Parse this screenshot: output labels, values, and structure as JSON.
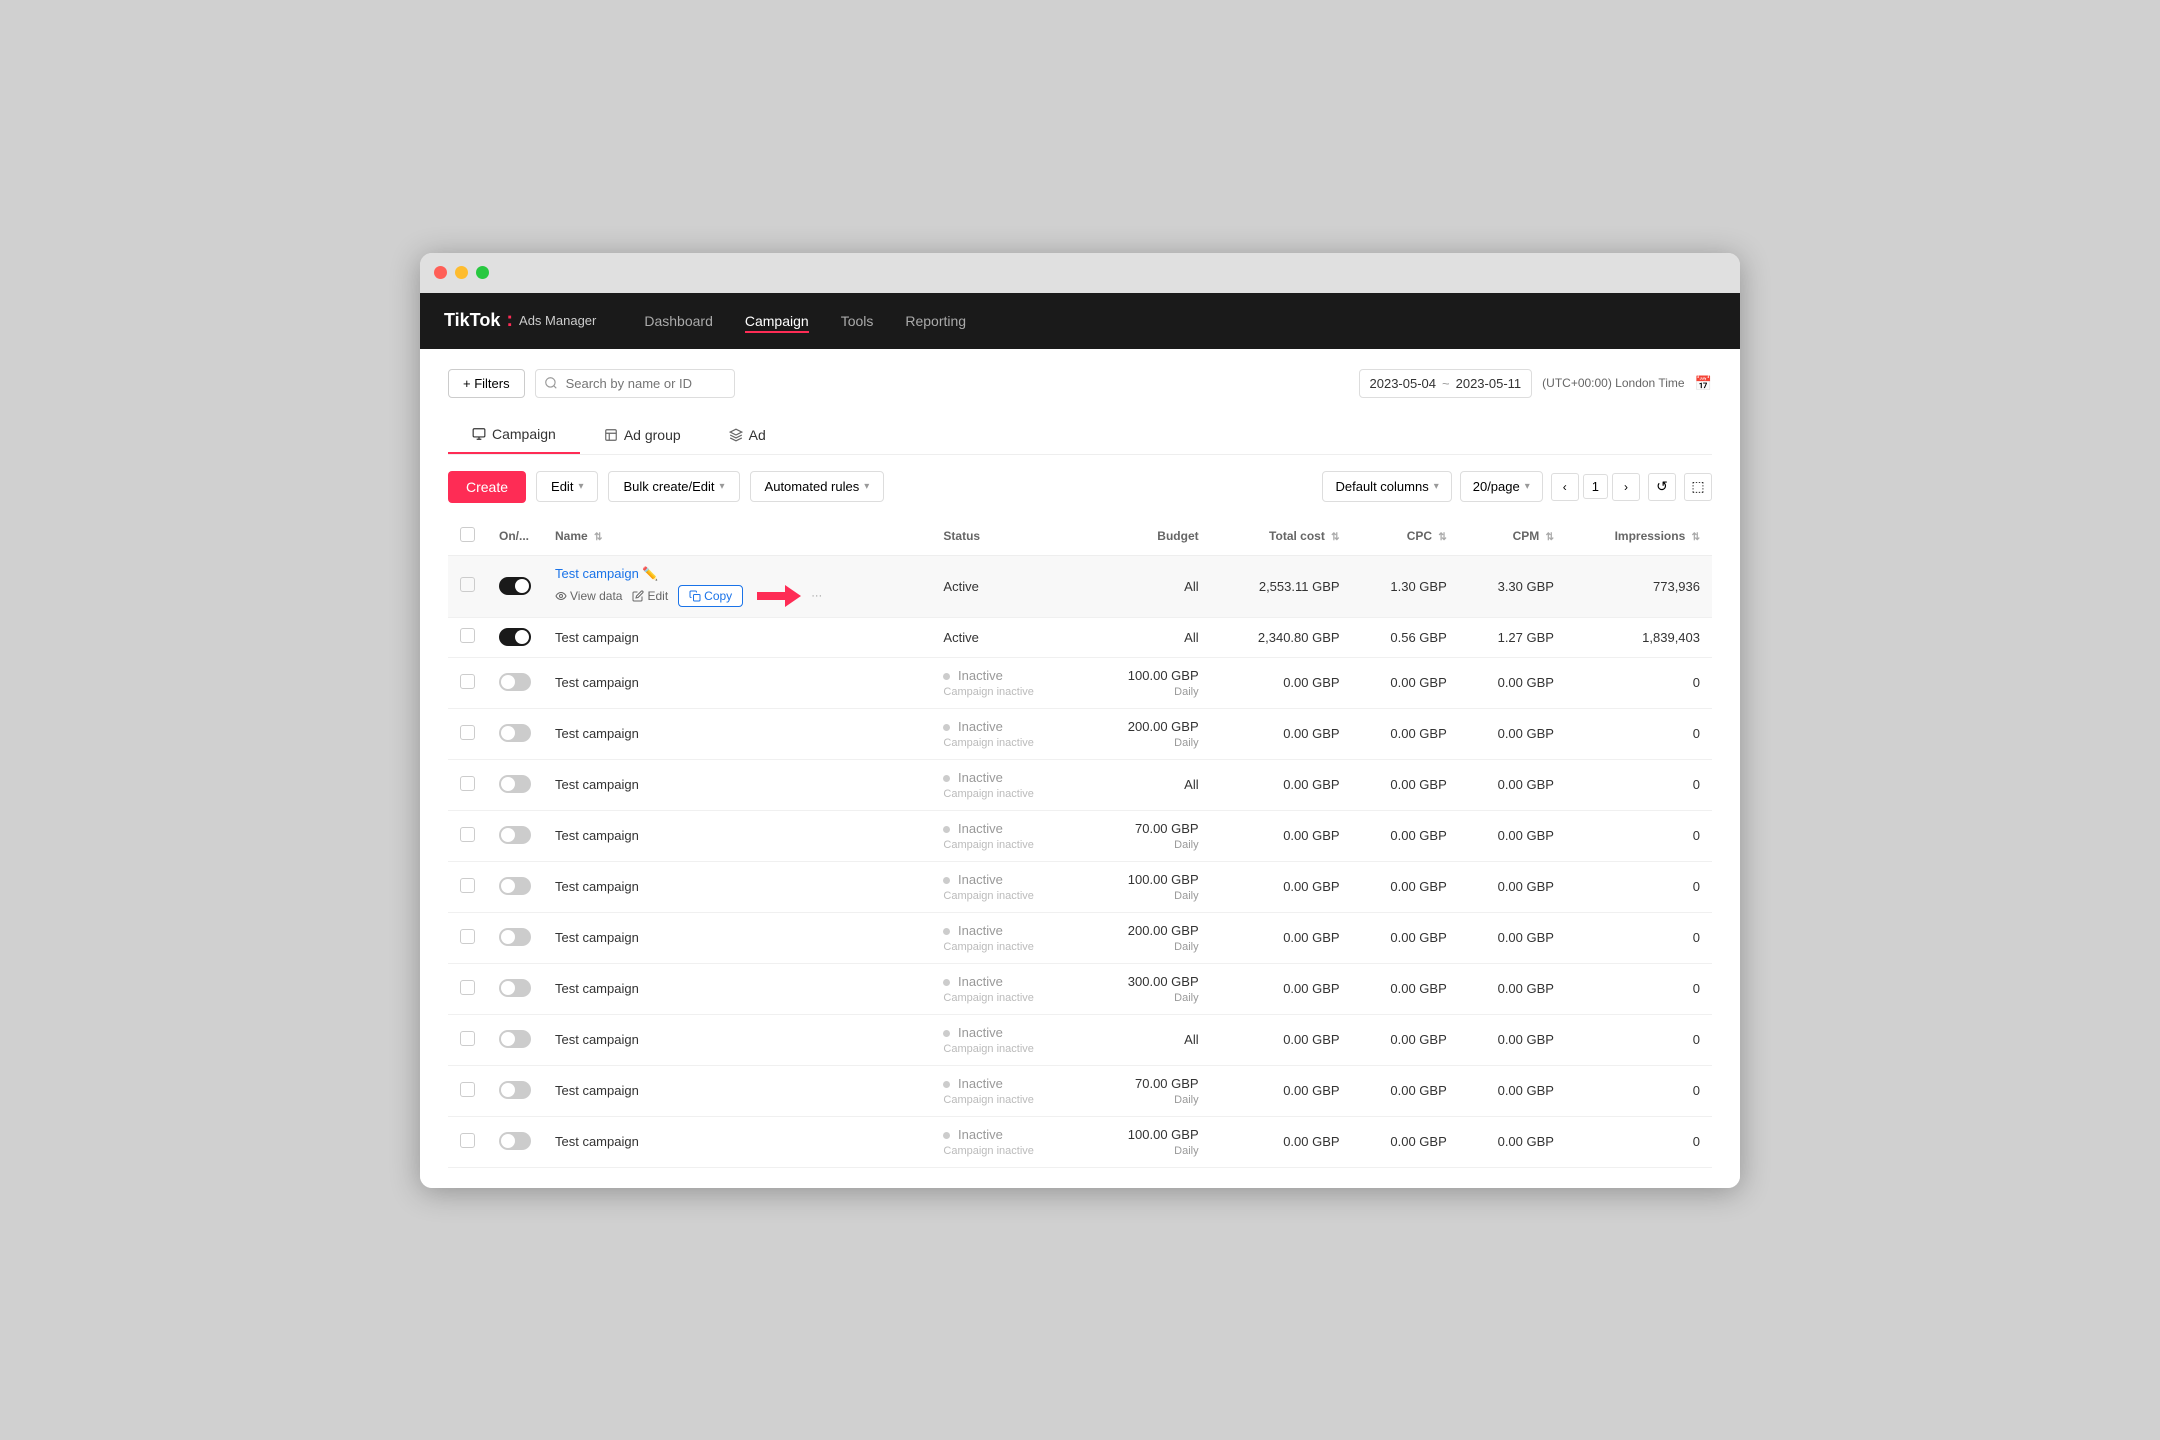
{
  "window": {
    "title": "TikTok Ads Manager"
  },
  "brand": {
    "name": "TikTok",
    "colon": ":",
    "sub": "Ads Manager"
  },
  "nav": {
    "items": [
      {
        "label": "Dashboard",
        "active": false
      },
      {
        "label": "Campaign",
        "active": true
      },
      {
        "label": "Tools",
        "active": false
      },
      {
        "label": "Reporting",
        "active": false
      }
    ]
  },
  "toolbar": {
    "filters_label": "+ Filters",
    "search_placeholder": "Search by name or ID",
    "date_from": "2023-05-04",
    "date_tilde": "~",
    "date_to": "2023-05-11",
    "timezone": "(UTC+00:00) London Time",
    "cal_icon": "📅"
  },
  "tabs": [
    {
      "label": "Campaign",
      "active": true
    },
    {
      "label": "Ad group",
      "active": false
    },
    {
      "label": "Ad",
      "active": false
    }
  ],
  "actions": {
    "create_label": "Create",
    "edit_label": "Edit",
    "bulk_label": "Bulk create/Edit",
    "auto_label": "Automated rules",
    "columns_label": "Default columns",
    "perpage_label": "20/page",
    "page_current": "1",
    "page_prev": "‹",
    "page_next": "›"
  },
  "table": {
    "headers": [
      {
        "label": "On/...",
        "sortable": false
      },
      {
        "label": "Name",
        "sortable": true
      },
      {
        "label": "Status",
        "sortable": false
      },
      {
        "label": "Budget",
        "sortable": false
      },
      {
        "label": "Total cost",
        "sortable": true
      },
      {
        "label": "CPC",
        "sortable": true
      },
      {
        "label": "CPM",
        "sortable": true
      },
      {
        "label": "Impressions",
        "sortable": true
      }
    ],
    "rows": [
      {
        "id": 1,
        "toggle": "on",
        "name": "Test campaign",
        "name_link": true,
        "status": "Active",
        "status_type": "active",
        "status_sub": "",
        "budget": "All",
        "total_cost": "2,553.11 GBP",
        "cpc": "1.30 GBP",
        "cpm": "3.30 GBP",
        "impressions": "773,936",
        "show_actions": true,
        "highlighted": true
      },
      {
        "id": 2,
        "toggle": "on",
        "name": "Test campaign",
        "name_link": false,
        "status": "Active",
        "status_type": "active",
        "status_sub": "",
        "budget": "All",
        "total_cost": "2,340.80 GBP",
        "cpc": "0.56 GBP",
        "cpm": "1.27 GBP",
        "impressions": "1,839,403",
        "show_actions": false,
        "highlighted": false
      },
      {
        "id": 3,
        "toggle": "off",
        "name": "Test campaign",
        "name_link": false,
        "status": "Inactive",
        "status_type": "inactive",
        "status_sub": "Campaign inactive",
        "budget": "100.00 GBP",
        "budget_sub": "Daily",
        "total_cost": "0.00 GBP",
        "cpc": "0.00 GBP",
        "cpm": "0.00 GBP",
        "impressions": "0",
        "show_actions": false,
        "highlighted": false
      },
      {
        "id": 4,
        "toggle": "off",
        "name": "Test campaign",
        "name_link": false,
        "status": "Inactive",
        "status_type": "inactive",
        "status_sub": "Campaign inactive",
        "budget": "200.00 GBP",
        "budget_sub": "Daily",
        "total_cost": "0.00 GBP",
        "cpc": "0.00 GBP",
        "cpm": "0.00 GBP",
        "impressions": "0",
        "show_actions": false,
        "highlighted": false
      },
      {
        "id": 5,
        "toggle": "off",
        "name": "Test campaign",
        "name_link": false,
        "status": "Inactive",
        "status_type": "inactive",
        "status_sub": "Campaign inactive",
        "budget": "All",
        "budget_sub": "",
        "total_cost": "0.00 GBP",
        "cpc": "0.00 GBP",
        "cpm": "0.00 GBP",
        "impressions": "0",
        "show_actions": false,
        "highlighted": false
      },
      {
        "id": 6,
        "toggle": "off",
        "name": "Test campaign",
        "name_link": false,
        "status": "Inactive",
        "status_type": "inactive",
        "status_sub": "Campaign inactive",
        "budget": "70.00 GBP",
        "budget_sub": "Daily",
        "total_cost": "0.00 GBP",
        "cpc": "0.00 GBP",
        "cpm": "0.00 GBP",
        "impressions": "0",
        "show_actions": false,
        "highlighted": false
      },
      {
        "id": 7,
        "toggle": "off",
        "name": "Test campaign",
        "name_link": false,
        "status": "Inactive",
        "status_type": "inactive",
        "status_sub": "Campaign inactive",
        "budget": "100.00 GBP",
        "budget_sub": "Daily",
        "total_cost": "0.00 GBP",
        "cpc": "0.00 GBP",
        "cpm": "0.00 GBP",
        "impressions": "0",
        "show_actions": false,
        "highlighted": false
      },
      {
        "id": 8,
        "toggle": "off",
        "name": "Test campaign",
        "name_link": false,
        "status": "Inactive",
        "status_type": "inactive",
        "status_sub": "Campaign inactive",
        "budget": "200.00 GBP",
        "budget_sub": "Daily",
        "total_cost": "0.00 GBP",
        "cpc": "0.00 GBP",
        "cpm": "0.00 GBP",
        "impressions": "0",
        "show_actions": false,
        "highlighted": false
      },
      {
        "id": 9,
        "toggle": "off",
        "name": "Test campaign",
        "name_link": false,
        "status": "Inactive",
        "status_type": "inactive",
        "status_sub": "Campaign inactive",
        "budget": "300.00 GBP",
        "budget_sub": "Daily",
        "total_cost": "0.00 GBP",
        "cpc": "0.00 GBP",
        "cpm": "0.00 GBP",
        "impressions": "0",
        "show_actions": false,
        "highlighted": false
      },
      {
        "id": 10,
        "toggle": "off",
        "name": "Test campaign",
        "name_link": false,
        "status": "Inactive",
        "status_type": "inactive",
        "status_sub": "Campaign inactive",
        "budget": "All",
        "budget_sub": "",
        "total_cost": "0.00 GBP",
        "cpc": "0.00 GBP",
        "cpm": "0.00 GBP",
        "impressions": "0",
        "show_actions": false,
        "highlighted": false
      },
      {
        "id": 11,
        "toggle": "off",
        "name": "Test campaign",
        "name_link": false,
        "status": "Inactive",
        "status_type": "inactive",
        "status_sub": "Campaign inactive",
        "budget": "70.00 GBP",
        "budget_sub": "Daily",
        "total_cost": "0.00 GBP",
        "cpc": "0.00 GBP",
        "cpm": "0.00 GBP",
        "impressions": "0",
        "show_actions": false,
        "highlighted": false
      },
      {
        "id": 12,
        "toggle": "off",
        "name": "Test campaign",
        "name_link": false,
        "status": "Inactive",
        "status_type": "inactive",
        "status_sub": "Campaign inactive",
        "budget": "100.00 GBP",
        "budget_sub": "Daily",
        "total_cost": "0.00 GBP",
        "cpc": "0.00 GBP",
        "cpm": "0.00 GBP",
        "impressions": "0",
        "show_actions": false,
        "highlighted": false
      }
    ]
  },
  "copy_tooltip": {
    "label": "Copy",
    "view_data_label": "View data",
    "edit_label": "Edit"
  }
}
